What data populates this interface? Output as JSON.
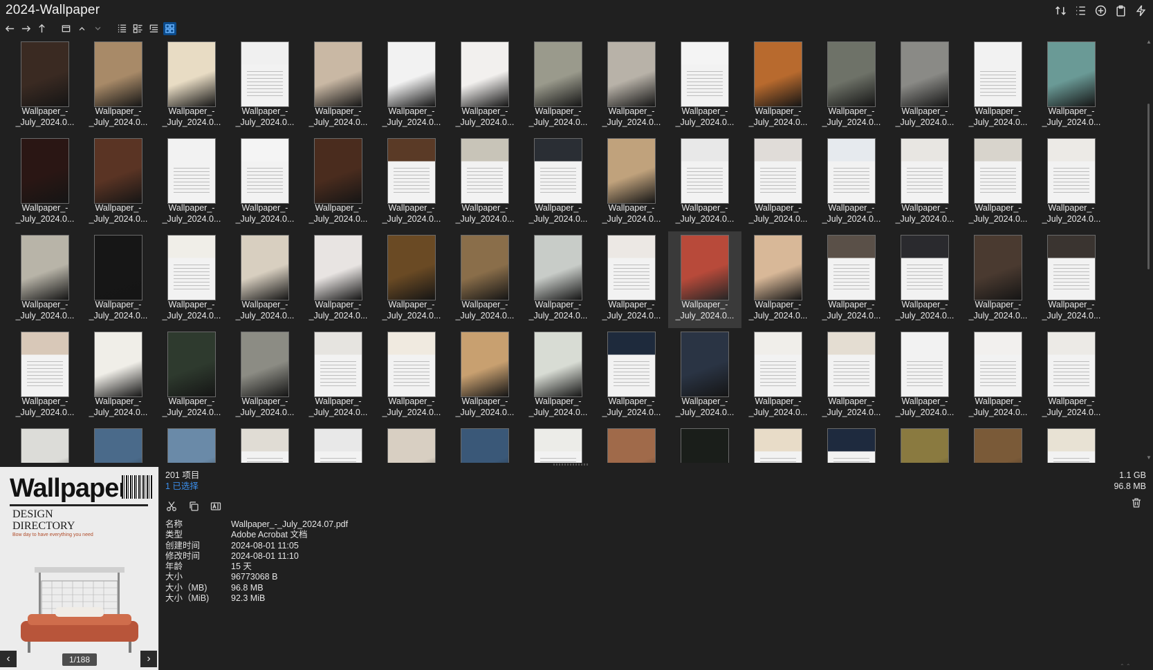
{
  "window": {
    "title": "2024-Wallpaper"
  },
  "top_actions": [
    {
      "name": "sort-icon",
      "glyph": "sort"
    },
    {
      "name": "list-options-icon",
      "glyph": "list"
    },
    {
      "name": "add-icon",
      "glyph": "plus"
    },
    {
      "name": "clipboard-icon",
      "glyph": "clip"
    },
    {
      "name": "bolt-icon",
      "glyph": "bolt"
    }
  ],
  "toolbar": {
    "items": [
      {
        "name": "back-icon",
        "glyph": "←"
      },
      {
        "name": "forward-icon",
        "glyph": "→"
      },
      {
        "name": "up-icon",
        "glyph": "↑"
      },
      {
        "name": "window-icon",
        "glyph": "▭"
      },
      {
        "name": "chevron-up-icon",
        "glyph": "⌃"
      },
      {
        "name": "chevron-down-icon",
        "glyph": "⌄"
      },
      {
        "name": "details-view-icon",
        "glyph": "≡"
      },
      {
        "name": "tiles-view-icon",
        "glyph": "▤"
      },
      {
        "name": "tree-view-icon",
        "glyph": "☰"
      },
      {
        "name": "thumbnails-view-icon",
        "glyph": "▦",
        "active": true
      }
    ]
  },
  "grid": {
    "file_label_line1": "Wallpaper_-",
    "file_label_line2": "_July_2024.0...",
    "selected_index": 39,
    "thumb_colors": [
      "#3a2a22",
      "#a88a68",
      "#e8dcc4",
      "#f0f0f0",
      "#c9b8a4",
      "#f2f2f2",
      "#f2f0ee",
      "#9a9a8c",
      "#b8b2a8",
      "#f4f4f4",
      "#b86a2e",
      "#6e7268",
      "#8a8a86",
      "#f2f2f2",
      "#6a9a96",
      "#2a1614",
      "#5a3424",
      "#f2f2f2",
      "#f4f4f4",
      "#4a2c1e",
      "#5a3a26",
      "#c8c4b8",
      "#2a2e34",
      "#c0a27c",
      "#e8e8e8",
      "#e0dcd8",
      "#e6eaee",
      "#e8e6e2",
      "#d8d4cc",
      "#eceae6",
      "#b8b4a8",
      "#161616",
      "#f0eee8",
      "#d8cfc0",
      "#e8e4e2",
      "#6a4a24",
      "#8a6e4a",
      "#c8ccc8",
      "#ece8e4",
      "#b84a3a",
      "#d8b898",
      "#5a5048",
      "#2a2a2e",
      "#4a3a30",
      "#3a3430",
      "#d8c8b8",
      "#f0eee8",
      "#2e3a2e",
      "#8c8c84",
      "#e6e4e0",
      "#f0eae0",
      "#c8a070",
      "#d8dcd4",
      "#1e2a3c",
      "#2a3444",
      "#f0eeea",
      "#e4ddd2",
      "#f2f2f2",
      "#f2f0ee",
      "#eceae6",
      "#dcdcd8",
      "#4a6a8a",
      "#6a8aa8",
      "#e0dcd4",
      "#e8e8e8",
      "#d8cfc2",
      "#3a5878",
      "#ecece8",
      "#a06a4a",
      "#1a1e1a",
      "#e8dcc8",
      "#1e2a3e",
      "#8a7a40",
      "#7a5a38",
      "#e8e2d4"
    ],
    "text_pages": [
      3,
      9,
      13,
      17,
      18,
      20,
      21,
      22,
      24,
      25,
      26,
      27,
      28,
      29,
      32,
      38,
      41,
      42,
      44,
      45,
      49,
      50,
      53,
      55,
      56,
      57,
      58,
      59,
      63,
      64,
      67,
      70,
      71,
      74
    ]
  },
  "preview": {
    "logo": "Wallpaper*",
    "headline": "DESIGN\nDIRECTORY",
    "subline": "Bow day to have everything you need",
    "page": "1/188"
  },
  "info": {
    "item_count": "201 项目",
    "selected": "1 已选择",
    "properties": [
      {
        "key": "名称",
        "value": "Wallpaper_-_July_2024.07.pdf"
      },
      {
        "key": "类型",
        "value": "Adobe Acrobat 文档"
      },
      {
        "key": "创建时间",
        "value": "2024-08-01  11:05"
      },
      {
        "key": "修改时间",
        "value": "2024-08-01  11:10"
      },
      {
        "key": "年龄",
        "value": "15 天"
      },
      {
        "key": "大小",
        "value": "96773068 B"
      },
      {
        "key": "大小（MB)",
        "value": "96.8 MB"
      },
      {
        "key": "大小（MiB)",
        "value": "92.3 MiB"
      }
    ],
    "total_size": "1.1 GB",
    "selected_size": "96.8 MB"
  }
}
